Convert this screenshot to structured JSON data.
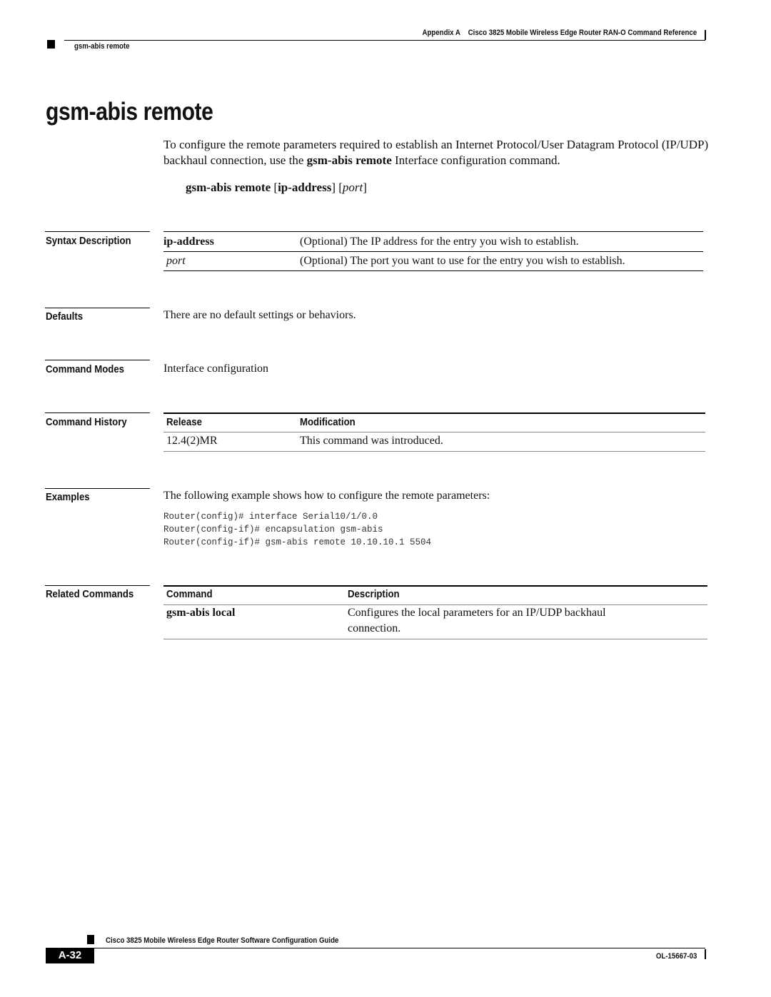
{
  "header": {
    "appendix": "Appendix A",
    "book_title": "Cisco 3825 Mobile Wireless Edge Router RAN-O Command Reference",
    "running_head": "gsm-abis remote"
  },
  "title": "gsm-abis remote",
  "intro": {
    "part1": "To configure the remote parameters required to establish an Internet Protocol/User Datagram Protocol (IP/UDP) backhaul connection, use the ",
    "command": "gsm-abis remote",
    "part2": " Interface configuration command."
  },
  "syntax": {
    "command": "gsm-abis remote",
    "open1": " [",
    "arg1": "ip-address",
    "close1": "]",
    "open2": " [",
    "arg2": "port",
    "close2": "]"
  },
  "syntax_description": {
    "label": "Syntax Description",
    "rows": [
      {
        "term": "ip-address",
        "desc": "(Optional) The IP address for the entry you wish to establish."
      },
      {
        "term": "port",
        "desc": "(Optional) The port you want to use for the entry you wish to establish."
      }
    ]
  },
  "defaults": {
    "label": "Defaults",
    "text": "There are no default settings or behaviors."
  },
  "command_modes": {
    "label": "Command Modes",
    "text": "Interface configuration"
  },
  "command_history": {
    "label": "Command History",
    "headers": [
      "Release",
      "Modification"
    ],
    "rows": [
      {
        "release": "12.4(2)MR",
        "modification": "This command was introduced."
      }
    ]
  },
  "examples": {
    "label": "Examples",
    "text": "The following example shows how to configure the remote parameters:",
    "code": [
      "Router(config)# interface Serial10/1/0.0",
      "Router(config-if)# encapsulation gsm-abis",
      "Router(config-if)# gsm-abis remote 10.10.10.1 5504"
    ]
  },
  "related_commands": {
    "label": "Related Commands",
    "headers": [
      "Command",
      "Description"
    ],
    "rows": [
      {
        "command": "gsm-abis local",
        "desc_line1": "Configures the local parameters for an IP/UDP backhaul",
        "desc_line2": "connection."
      }
    ]
  },
  "footer": {
    "guide_title": "Cisco 3825 Mobile Wireless Edge Router Software Configuration Guide",
    "page": "A-32",
    "doc_number": "OL-15667-03"
  }
}
